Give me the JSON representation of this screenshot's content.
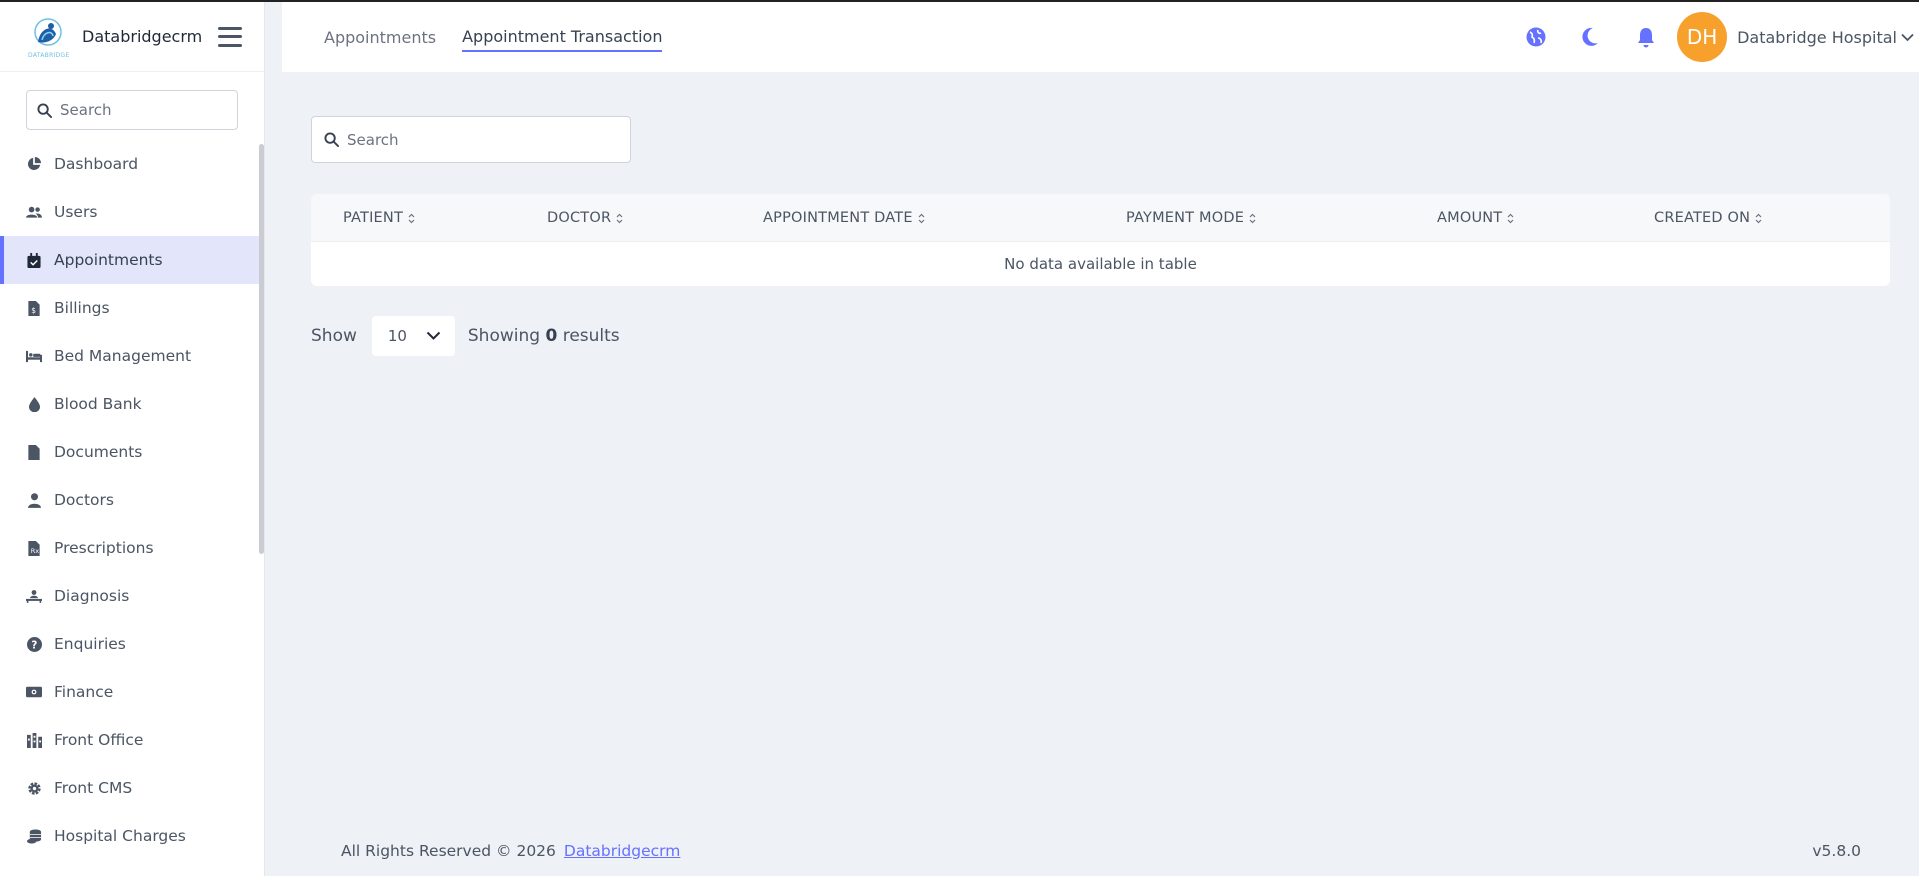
{
  "brand": {
    "name": "Databridgecrm",
    "logo_text": "DATABRIDGE"
  },
  "sidebar": {
    "search_placeholder": "Search",
    "items": [
      {
        "label": "Dashboard",
        "icon": "chart-pie-icon"
      },
      {
        "label": "Users",
        "icon": "users-icon"
      },
      {
        "label": "Appointments",
        "icon": "calendar-check-icon",
        "active": true
      },
      {
        "label": "Billings",
        "icon": "file-invoice-icon"
      },
      {
        "label": "Bed Management",
        "icon": "bed-icon"
      },
      {
        "label": "Blood Bank",
        "icon": "droplet-icon"
      },
      {
        "label": "Documents",
        "icon": "file-icon"
      },
      {
        "label": "Doctors",
        "icon": "user-doctor-icon"
      },
      {
        "label": "Prescriptions",
        "icon": "prescription-icon"
      },
      {
        "label": "Diagnosis",
        "icon": "diagnosis-icon"
      },
      {
        "label": "Enquiries",
        "icon": "question-circle-icon"
      },
      {
        "label": "Finance",
        "icon": "money-bill-icon"
      },
      {
        "label": "Front Office",
        "icon": "building-icon"
      },
      {
        "label": "Front CMS",
        "icon": "gear-icon"
      },
      {
        "label": "Hospital Charges",
        "icon": "coins-icon"
      }
    ]
  },
  "topbar": {
    "tabs": [
      {
        "label": "Appointments",
        "active": false
      },
      {
        "label": "Appointment Transaction",
        "active": true
      }
    ],
    "user": {
      "initials": "DH",
      "name": "Databridge Hospital"
    }
  },
  "main": {
    "search_placeholder": "Search",
    "table": {
      "columns": [
        "PATIENT",
        "DOCTOR",
        "APPOINTMENT DATE",
        "PAYMENT MODE",
        "AMOUNT",
        "CREATED ON"
      ],
      "empty_message": "No data available in table"
    },
    "pager": {
      "show_label": "Show",
      "per_page": "10",
      "showing_prefix": "Showing",
      "count": "0",
      "showing_suffix": "results"
    }
  },
  "footer": {
    "copyright": "All Rights Reserved © 2026",
    "link": "Databridgecrm",
    "version": "v5.8.0"
  },
  "colors": {
    "accent": "#6571ff",
    "avatar": "#f7a12c",
    "background": "#eef1f6"
  }
}
